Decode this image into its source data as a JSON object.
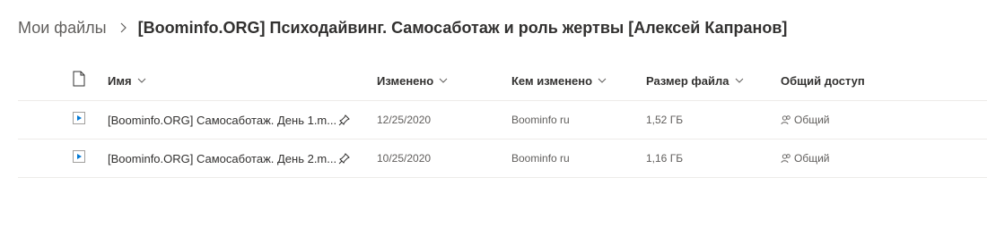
{
  "breadcrumb": {
    "root": "Мои файлы",
    "current": "[Boominfo.ORG] Психодайвинг. Самосаботаж и роль жертвы [Алексей Капранов]"
  },
  "columns": {
    "name": "Имя",
    "modified": "Изменено",
    "modified_by": "Кем изменено",
    "file_size": "Размер файла",
    "sharing": "Общий доступ"
  },
  "files": [
    {
      "name": "[Boominfo.ORG] Самосаботаж. День 1.m...",
      "modified": "12/25/2020",
      "modified_by": "Boominfo ru",
      "size": "1,52 ГБ",
      "sharing": "Общий",
      "icon": "video-file-icon"
    },
    {
      "name": "[Boominfo.ORG] Самосаботаж. День 2.m...",
      "modified": "10/25/2020",
      "modified_by": "Boominfo ru",
      "size": "1,16 ГБ",
      "sharing": "Общий",
      "icon": "video-file-icon"
    }
  ],
  "colors": {
    "text": "#323130",
    "secondary": "#605e5c",
    "divider": "#edebe9",
    "accent": "#0078d4"
  }
}
